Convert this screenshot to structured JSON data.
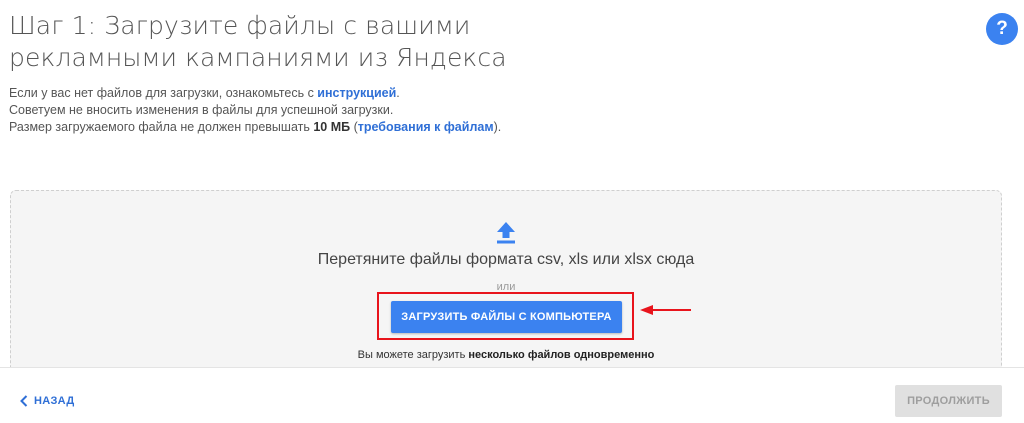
{
  "header": {
    "title": "Шаг 1: Загрузите файлы с вашими рекламными кампаниями из Яндекса",
    "help_label": "?"
  },
  "info": {
    "line1_text": "Если у вас нет файлов для загрузки, ознакомьтесь с ",
    "line1_link": "инструкцией",
    "line1_end": ".",
    "line2_text": "Советуем не вносить изменения в файлы для успешной загрузки.",
    "line3_text": "Размер загружаемого файла не должен превышать ",
    "line3_size": "10 МБ",
    "line3_open": " (",
    "line3_link": "требования к файлам",
    "line3_end": ")."
  },
  "dropzone": {
    "icon": "upload-arrow-icon",
    "drop_text": "Перетяните файлы формата csv, xls или xlsx сюда",
    "or_text": "или",
    "upload_button": "Загрузить файлы с компьютера",
    "multi_text": "Вы можете загрузить ",
    "multi_bold": "несколько файлов одновременно"
  },
  "footer": {
    "back_label": "Назад",
    "continue_label": "Продолжить"
  },
  "colors": {
    "accent": "#3b82f0",
    "link": "#2f6fd6",
    "highlight": "#e8141c",
    "disabled": "#e0e0e0"
  }
}
